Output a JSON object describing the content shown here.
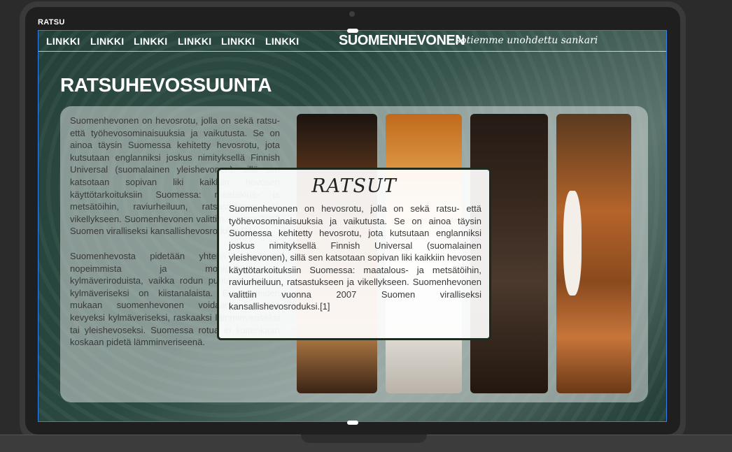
{
  "window": {
    "label": "RATSU"
  },
  "nav": {
    "links": [
      "LINKKI",
      "LINKKI",
      "LINKKI",
      "LINKKI",
      "LINKKI",
      "LINKKI"
    ],
    "brand": "SUOMENHEVONEN",
    "tagline": "sotiemme unohdettu sankari"
  },
  "main": {
    "title": "RATSUHEVOSSUUNTA",
    "paragraphs": [
      "Suomenhevonen on hevosrotu, jolla on sekä ratsu- että työhevosominaisuuksia ja vaikutusta. Se on ainoa täysin Suomessa kehitetty hevosrotu, jota kutsutaan englanniksi joskus nimityksellä Finnish Universal (suomalainen yleishevonen), sillä sen katsotaan sopivan liki kaikkiin hevosen käyttötarkoituksiin Suomessa: maatalous- ja metsätöihin, raviurheiluun, ratsastukseen ja vikellykseen. Suomenhevonen valittiin vuonna 2007 Suomen viralliseksi kansallishevosroduksi.[1]",
      "Suomenhevosta pidetään yhtenä maailman nopeimmista ja monipuolisimmista kylmäveriroduista, vaikka rodun puhtautta aidoksi kylmäveriseksi on kiistanalaista. Eri lähteiden mukaan suomenhevonen voidaan luokitella kevyeksi kylmäveriseksi, raskaaksi lämminveriseksi tai yleishevoseksi. Suomessa rotua ei kuitenkaan koskaan pidetä lämminveriseenä."
    ],
    "photos": [
      "horse-photo",
      "horse-photo",
      "horse-photo",
      "horse-photo"
    ]
  },
  "modal": {
    "title": "RATSUT",
    "text": "Suomenhevonen on hevosrotu, jolla on sekä ratsu- että työhevosominaisuuksia ja vaikutusta. Se on ainoa täysin Suomessa kehitetty hevosrotu, jota kutsutaan englanniksi joskus nimityksellä Finnish Universal (suomalainen yleishevonen), sillä sen katsotaan sopivan liki kaikkiin hevosen käyttötarkoituksiin Suomessa: maatalous- ja metsätöihin, raviurheiluun, ratsastukseen ja vikellykseen. Suomenhevonen valittiin vuonna 2007 Suomen viralliseksi kansallishevosroduksi.[1]"
  },
  "colors": {
    "selection": "#2f80ed",
    "modal_border": "#1e2a1d"
  }
}
